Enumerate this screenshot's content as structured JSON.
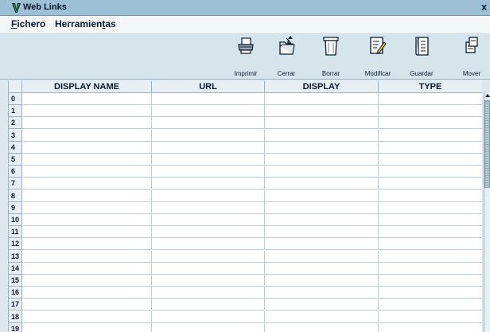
{
  "window": {
    "title": "Web Links",
    "close_label": "x"
  },
  "menu": {
    "items": [
      {
        "pre": "",
        "u": "F",
        "post": "ichero"
      },
      {
        "pre": "Herramien",
        "u": "t",
        "post": "as"
      }
    ]
  },
  "toolbar": {
    "buttons": [
      {
        "label": "Imprimir",
        "icon": "printer-icon"
      },
      {
        "label": "Cerrar",
        "icon": "folder-close-icon"
      },
      {
        "label": "Borrar",
        "icon": "trash-icon"
      },
      {
        "label": "Modificar",
        "icon": "edit-icon"
      },
      {
        "label": "Guardar",
        "icon": "save-book-icon"
      },
      {
        "label": "Mover",
        "icon": "move-icon"
      }
    ]
  },
  "table": {
    "columns": [
      "DISPLAY NAME",
      "URL",
      "DISPLAY",
      "TYPE"
    ],
    "row_labels": [
      "0",
      "1",
      "2",
      "3",
      "4",
      "5",
      "6",
      "7",
      "8",
      "9",
      "10",
      "11",
      "12",
      "13",
      "14",
      "15",
      "16",
      "17",
      "18",
      "19"
    ]
  },
  "colors": {
    "titlebar": "#9ec0d4",
    "toolbar": "#d6e4eb",
    "grid_border": "#97b3c4"
  }
}
